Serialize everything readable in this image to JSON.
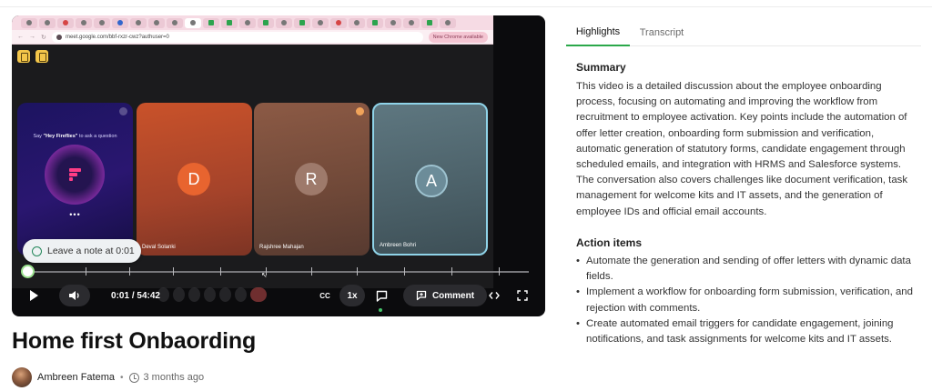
{
  "video": {
    "title": "Home first Onbaording",
    "author": "Ambreen Fatema",
    "posted": "3 months ago",
    "time": "0:01 / 54:42",
    "speed": "1x",
    "cc_label": "CC",
    "comment_label": "Comment",
    "note_prompt": "Leave a note at 0:01",
    "progress_percent": 0
  },
  "meeting": {
    "url": "meet.google.com/bbf-rxzr-cwz?authuser=0",
    "chrome_badge": "New Chrome available",
    "ask_prompt_prefix": "Say ",
    "ask_prompt_bold": "\"Hey Fireflies\"",
    "ask_prompt_suffix": " to ask a question",
    "ff_dots": "•••",
    "participants": [
      {
        "initial": "D",
        "name": "Deval Solanki"
      },
      {
        "initial": "R",
        "name": "Rajshree Mahajan"
      },
      {
        "initial": "A",
        "name": "Ambreen Bohri"
      }
    ]
  },
  "panel": {
    "tabs": [
      "Highlights",
      "Transcript"
    ],
    "active_tab": "Highlights",
    "summary_title": "Summary",
    "summary_text": "This video is a detailed discussion about the employee onboarding process, focusing on automating and improving the workflow from recruitment to employee activation. Key points include the automation of offer letter creation, onboarding form submission and verification, automatic generation of statutory forms, candidate engagement through scheduled emails, and integration with HRMS and Salesforce systems. The conversation also covers challenges like document verification, task management for welcome kits and IT assets, and the generation of employee IDs and official email accounts.",
    "actions_title": "Action items",
    "actions": [
      "Automate the generation and sending of offer letters with dynamic data fields.",
      "Implement a workflow for onboarding form submission, verification, and rejection with comments.",
      "Create automated email triggers for candidate engagement, joining notifications, and task assignments for welcome kits and IT assets."
    ]
  },
  "colors": {
    "accent": "#2ba84a",
    "active_tile_border": "#8fd3e8"
  },
  "icons": [
    "play-icon",
    "volume-icon",
    "captions-icon",
    "chat-icon",
    "comment-icon",
    "code-icon",
    "fullscreen-icon",
    "note-icon",
    "clock-icon"
  ]
}
